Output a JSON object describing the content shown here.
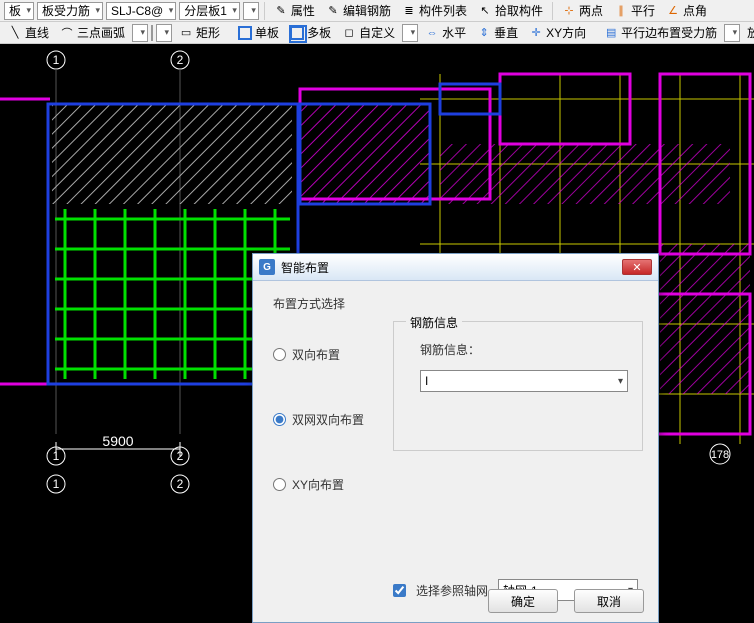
{
  "toolbar1": {
    "dd1": "板",
    "dd2": "板受力筋",
    "dd3": "SLJ-C8@",
    "dd4": "分层板1",
    "attr": "属性",
    "edit_rebar": "编辑钢筋",
    "part_list": "构件列表",
    "pick_part": "拾取构件",
    "grid_pt": "两点",
    "parallel": "平行",
    "pt_angle": "点角"
  },
  "toolbar2": {
    "line": "直线",
    "arc": "三点画弧",
    "rect": "矩形",
    "single": "单板",
    "multi": "多板",
    "custom": "自定义",
    "horiz": "水平",
    "vert": "垂直",
    "xy": "XY方向",
    "edge": "平行边布置受力筋",
    "place": "放"
  },
  "dialog": {
    "title": "智能布置",
    "method_label": "布置方式选择",
    "opt_biaxial": "双向布置",
    "opt_dblnet": "双网双向布置",
    "opt_xy": "XY向布置",
    "rebar_group": "钢筋信息",
    "rebar_label": "钢筋信息：",
    "rebar_value": "I",
    "ref_check": "选择参照轴网",
    "ref_value": "轴网-1",
    "ok": "确定",
    "cancel": "取消"
  },
  "axes": {
    "top1": "1",
    "top2": "2",
    "bot1": "1",
    "bot2": "2",
    "botR": "178",
    "dim": "5900"
  }
}
